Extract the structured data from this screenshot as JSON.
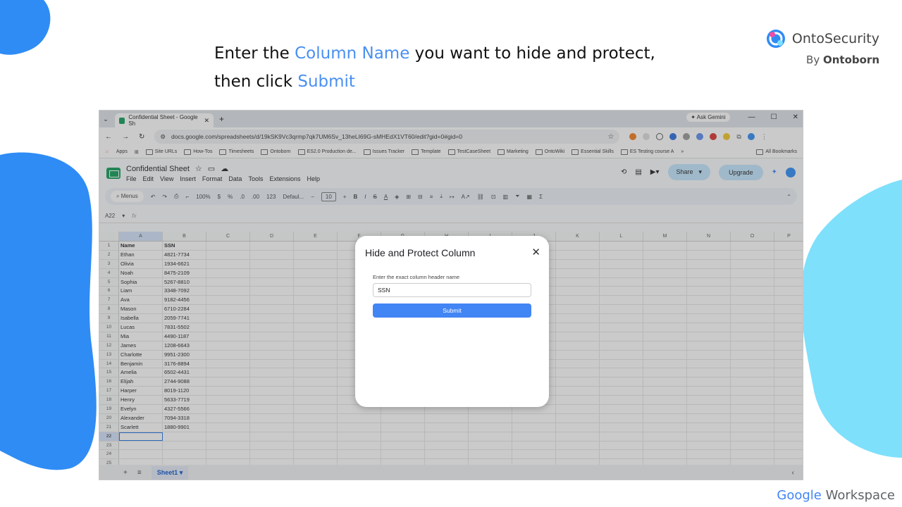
{
  "headline": {
    "l1_a": "Enter the ",
    "l1_hl": "Column Name",
    "l1_b": " you want to hide and protect,",
    "l2_a": "then click ",
    "l2_hl": "Submit"
  },
  "brand": {
    "name": "OntoSecurity",
    "by": "By ",
    "by_name": "Ontoborn"
  },
  "workspace": {
    "google": "Google",
    "workspace": " Workspace"
  },
  "colors": {
    "accent": "#4a8ff2",
    "blob_blue": "#2f8cf5",
    "blob_cyan": "#7ee0fb",
    "sheets_green": "#0f9d58",
    "submit_blue": "#4285f4"
  },
  "browser": {
    "tab_title": "Confidential Sheet - Google Sh",
    "ask_gemini": "Ask Gemini",
    "url": "docs.google.com/spreadsheets/d/19kSK9Vc3qrmp7qk7UM6Sv_13heLI69G-sMHEdX1VT60/edit?gid=0#gid=0",
    "bookmarks": [
      "Site URLs",
      "How-Tos",
      "Timesheets",
      "Ontoborn",
      "ES2.0 Production de...",
      "Issues Tracker",
      "Template",
      "TestCaseSheet",
      "Marketing",
      "OntoWiki",
      "Essential Skills",
      "ES Testing course A"
    ],
    "apps": "Apps",
    "all_bookmarks": "All Bookmarks"
  },
  "sheets": {
    "title": "Confidential Sheet",
    "menu": [
      "File",
      "Edit",
      "View",
      "Insert",
      "Format",
      "Data",
      "Tools",
      "Extensions",
      "Help"
    ],
    "share": "Share",
    "upgrade": "Upgrade",
    "toolbar": {
      "menus": "Menus",
      "zoom": "100%",
      "currency": "$",
      "percent": "%",
      "dec_dec": ".0",
      "inc_dec": ".00",
      "num_fmt": "123",
      "font": "Defaul...",
      "font_size": "10"
    },
    "cell_ref": "A22",
    "fx": "fx",
    "columns": [
      "A",
      "B",
      "C",
      "D",
      "E",
      "F",
      "G",
      "H",
      "I",
      "J",
      "K",
      "L",
      "M",
      "N",
      "O",
      "P"
    ],
    "header_row": [
      "Name",
      "SSN"
    ],
    "rows": [
      [
        "Ethan",
        "4821-7734"
      ],
      [
        "Olivia",
        "1934-6621"
      ],
      [
        "Noah",
        "8475-2109"
      ],
      [
        "Sophia",
        "5267-8810"
      ],
      [
        "Liam",
        "3348-7092"
      ],
      [
        "Ava",
        "9182-4456"
      ],
      [
        "Mason",
        "6710-2284"
      ],
      [
        "Isabella",
        "2059-7741"
      ],
      [
        "Lucas",
        "7831-5502"
      ],
      [
        "Mia",
        "4490-1187"
      ],
      [
        "James",
        "1208-6643"
      ],
      [
        "Charlotte",
        "9951-2300"
      ],
      [
        "Benjamin",
        "3176-8894"
      ],
      [
        "Amelia",
        "6502-4431"
      ],
      [
        "Elijah",
        "2744-9088"
      ],
      [
        "Harper",
        "8019-1120"
      ],
      [
        "Henry",
        "5633-7719"
      ],
      [
        "Evelyn",
        "4327-5566"
      ],
      [
        "Alexander",
        "7094-3318"
      ],
      [
        "Scarlett",
        "1880-9901"
      ]
    ],
    "sheet_tab": "Sheet1"
  },
  "dialog": {
    "title": "Hide and Protect Column",
    "label": "Enter the exact column header name",
    "input_value": "SSN",
    "submit": "Submit",
    "close": "✕"
  }
}
